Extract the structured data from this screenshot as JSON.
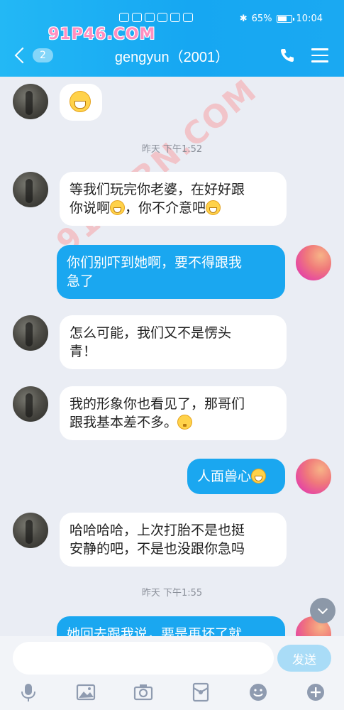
{
  "status": {
    "battery": "65%",
    "time": "10:04",
    "battery_level": 0.65
  },
  "watermark": {
    "top": "91P46.COM",
    "diagonal": "91PORN.COM"
  },
  "header": {
    "back_badge": "2",
    "title": "gengyun（2001）"
  },
  "messages": [
    {
      "side": "left",
      "text": ""
    },
    {
      "type": "time",
      "text": "昨天 下午1:52"
    },
    {
      "side": "left",
      "line1": "等我们玩完你老婆，在好好跟",
      "line2a": "你说啊",
      "line2b": "，你不介意吧"
    },
    {
      "side": "right",
      "line1": "你们别吓到她啊，要不得跟我",
      "line2": "急了"
    },
    {
      "side": "left",
      "line1": "怎么可能，我们又不是愣头",
      "line2": "青！"
    },
    {
      "side": "left",
      "line1": "我的形象你也看见了，那哥们",
      "line2": "跟我基本差不多。"
    },
    {
      "side": "right",
      "text": "人面兽心"
    },
    {
      "side": "left",
      "line1": "哈哈哈哈，上次打胎不是也挺",
      "line2": "安静的吧，不是也没跟你急吗"
    },
    {
      "type": "time",
      "text": "昨天 下午1:55"
    },
    {
      "side": "right",
      "text": "她回去跟我说，要是再坏了就"
    }
  ],
  "input": {
    "placeholder": "",
    "send_label": "发送"
  },
  "toolbar_icons": [
    "mic-icon",
    "image-icon",
    "camera-icon",
    "red-packet-icon",
    "emoji-icon",
    "plus-icon"
  ]
}
